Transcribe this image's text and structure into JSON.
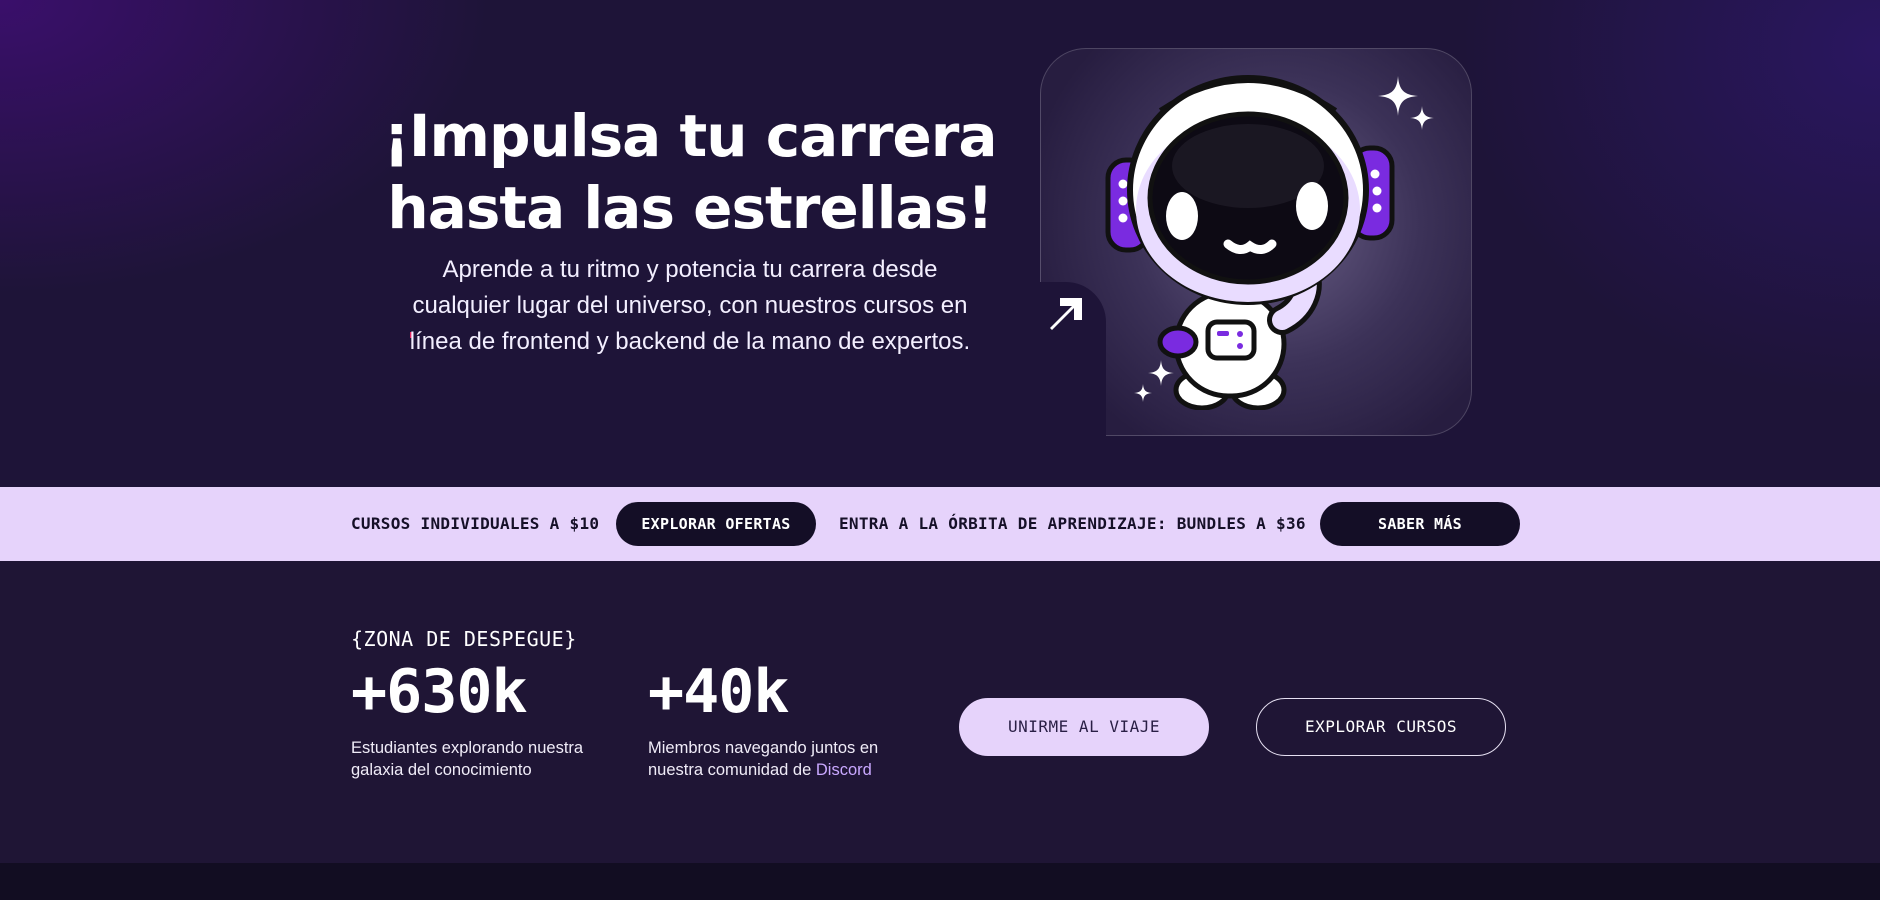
{
  "hero": {
    "title_line1": "¡Impulsa tu carrera",
    "title_line2": "hasta las estrellas!",
    "subtitle_line1": "Aprende a tu ritmo y potencia tu carrera desde",
    "subtitle_line2": "cualquier lugar del universo, con nuestros cursos en",
    "subtitle_line3": "línea de frontend y backend de la mano de expertos.",
    "illustration": "astronaut-mascot",
    "icons": [
      "arrow-up-right-icon",
      "sparkle-icon"
    ]
  },
  "promo": {
    "text1": "CURSOS INDIVIDUALES A $10",
    "button1": "EXPLORAR OFERTAS",
    "text2": "ENTRA A LA ÓRBITA DE APRENDIZAJE: BUNDLES A $36",
    "button2": "SABER MÁS"
  },
  "stats": {
    "label": "{ZONA DE DESPEGUE}",
    "students_number": "+630k",
    "students_desc_line1": "Estudiantes explorando nuestra",
    "students_desc_line2": "galaxia del conocimiento",
    "members_number": "+40k",
    "members_desc_line1": "Miembros navegando juntos en",
    "members_desc_line2_prefix": "nuestra comunidad de ",
    "members_desc_link": "Discord"
  },
  "cta": {
    "primary": "UNIRME AL VIAJE",
    "secondary": "EXPLORAR CURSOS"
  },
  "colors": {
    "lavender": "#e6d3fb",
    "dark": "#140e26",
    "purple_accent": "#7a2be0",
    "link": "#c9a8ff"
  }
}
